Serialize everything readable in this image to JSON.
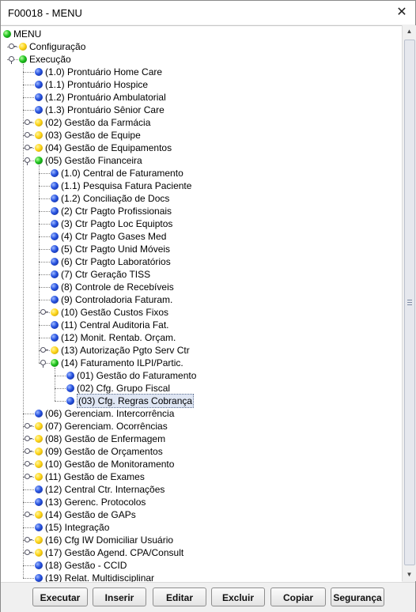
{
  "window": {
    "title": "F00018 - MENU",
    "close_glyph": "✕"
  },
  "tree": {
    "rows": [
      {
        "label": "MENU",
        "dot": "green"
      },
      {
        "label": "Configuração",
        "dot": "yellow"
      },
      {
        "label": "Execução",
        "dot": "green"
      },
      {
        "label": "(1.0) Prontuário Home Care",
        "dot": "blue"
      },
      {
        "label": "(1.1) Prontuário Hospice",
        "dot": "blue"
      },
      {
        "label": "(1.2) Prontuário Ambulatorial",
        "dot": "blue"
      },
      {
        "label": "(1.3) Prontuário Sênior Care",
        "dot": "blue"
      },
      {
        "label": "(02) Gestão da Farmácia",
        "dot": "yellow"
      },
      {
        "label": "(03) Gestão de Equipe",
        "dot": "yellow"
      },
      {
        "label": "(04) Gestão de Equipamentos",
        "dot": "yellow"
      },
      {
        "label": "(05) Gestão Financeira",
        "dot": "green"
      },
      {
        "label": "(1.0) Central de Faturamento",
        "dot": "blue"
      },
      {
        "label": "(1.1) Pesquisa Fatura Paciente",
        "dot": "blue"
      },
      {
        "label": "(1.2) Conciliação de Docs",
        "dot": "blue"
      },
      {
        "label": "(2) Ctr Pagto Profissionais",
        "dot": "blue"
      },
      {
        "label": "(3) Ctr Pagto Loc Equiptos",
        "dot": "blue"
      },
      {
        "label": "(4) Ctr Pagto Gases Med",
        "dot": "blue"
      },
      {
        "label": "(5) Ctr Pagto Unid Móveis",
        "dot": "blue"
      },
      {
        "label": "(6) Ctr Pagto Laboratórios",
        "dot": "blue"
      },
      {
        "label": "(7) Ctr Geração TISS",
        "dot": "blue"
      },
      {
        "label": "(8) Controle de Recebíveis",
        "dot": "blue"
      },
      {
        "label": "(9) Controladoria Faturam.",
        "dot": "blue"
      },
      {
        "label": "(10) Gestão Custos Fixos",
        "dot": "yellow"
      },
      {
        "label": "(11) Central Auditoria Fat.",
        "dot": "blue"
      },
      {
        "label": "(12) Monit. Rentab. Orçam.",
        "dot": "blue"
      },
      {
        "label": "(13) Autorização Pgto Serv Ctr",
        "dot": "yellow"
      },
      {
        "label": "(14) Faturamento ILPI/Partic.",
        "dot": "green"
      },
      {
        "label": "(01) Gestão do Faturamento",
        "dot": "blue"
      },
      {
        "label": "(02) Cfg. Grupo Fiscal",
        "dot": "blue"
      },
      {
        "label": "(03) Cfg. Regras Cobrança",
        "dot": "blue",
        "selected": true
      },
      {
        "label": "(06) Gerenciam. Intercorrência",
        "dot": "blue"
      },
      {
        "label": "(07) Gerenciam. Ocorrências",
        "dot": "yellow"
      },
      {
        "label": "(08) Gestão de Enfermagem",
        "dot": "yellow"
      },
      {
        "label": "(09) Gestão de Orçamentos",
        "dot": "yellow"
      },
      {
        "label": "(10) Gestão de Monitoramento",
        "dot": "yellow"
      },
      {
        "label": "(11) Gestão de Exames",
        "dot": "yellow"
      },
      {
        "label": "(12) Central Ctr. Internações",
        "dot": "blue"
      },
      {
        "label": "(13) Gerenc. Protocolos",
        "dot": "blue"
      },
      {
        "label": "(14) Gestão de GAPs",
        "dot": "yellow"
      },
      {
        "label": "(15) Integração",
        "dot": "blue"
      },
      {
        "label": "(16) Cfg IW Domiciliar Usuário",
        "dot": "yellow"
      },
      {
        "label": "(17) Gestão Agend. CPA/Consult",
        "dot": "yellow"
      },
      {
        "label": "(18) Gestão - CCID",
        "dot": "blue"
      },
      {
        "label": "(19) Relat. Multidisciplinar",
        "dot": "blue"
      }
    ]
  },
  "buttons": {
    "executar": "Executar",
    "inserir": "Inserir",
    "editar": "Editar",
    "excluir": "Excluir",
    "copiar": "Copiar",
    "seguranca": "Segurança"
  },
  "scrollbar": {
    "up_glyph": "▲",
    "down_glyph": "▼"
  }
}
